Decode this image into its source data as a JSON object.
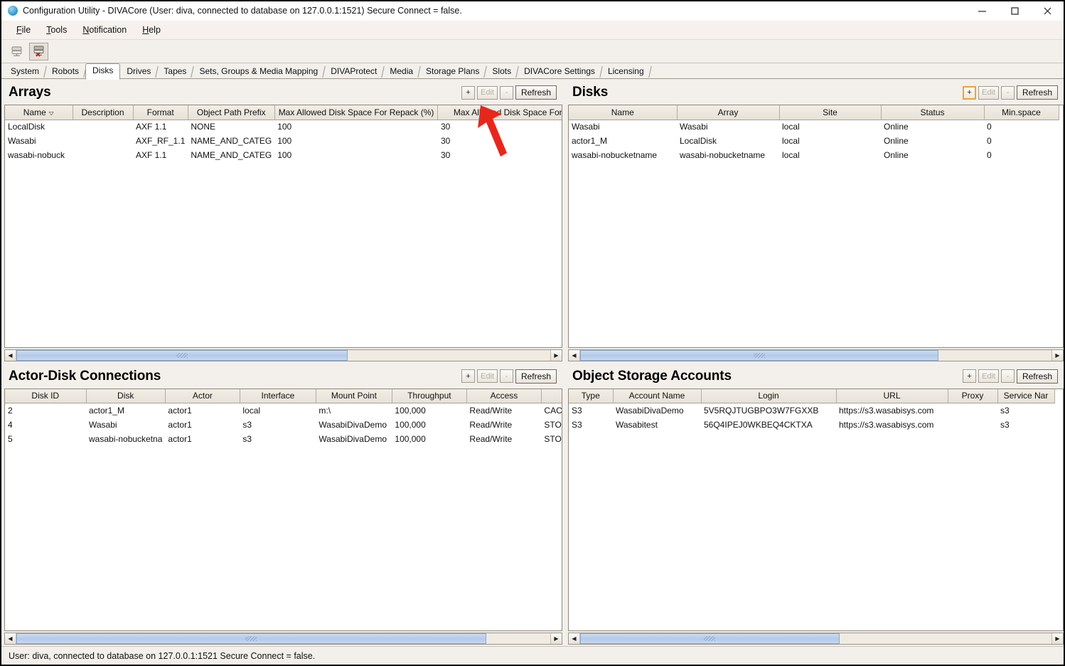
{
  "window": {
    "title": "Configuration Utility - DIVACore (User: diva, connected to database on 127.0.0.1:1521) Secure Connect = false.",
    "minimize_label": "–",
    "maximize_label": "□",
    "close_label": "✕"
  },
  "menubar": {
    "items": [
      {
        "label": "File",
        "mnemonic": "F"
      },
      {
        "label": "Tools",
        "mnemonic": "T"
      },
      {
        "label": "Notification",
        "mnemonic": "N"
      },
      {
        "label": "Help",
        "mnemonic": "H"
      }
    ]
  },
  "toolbar": {
    "buttons": [
      {
        "name": "connect-database-icon",
        "title": "Connect"
      },
      {
        "name": "disconnect-database-icon",
        "title": "Disconnect"
      }
    ]
  },
  "tabs": {
    "selected": "Disks",
    "items": [
      "System",
      "Robots",
      "Disks",
      "Drives",
      "Tapes",
      "Sets, Groups & Media Mapping",
      "DIVAProtect",
      "Media",
      "Storage Plans",
      "Slots",
      "DIVACore Settings",
      "Licensing"
    ]
  },
  "common": {
    "add_label": "+",
    "edit_label": "Edit",
    "remove_label": "-",
    "refresh_label": "Refresh"
  },
  "arrays": {
    "title": "Arrays",
    "columns": [
      "Name",
      "Description",
      "Format",
      "Object Path Prefix",
      "Max Allowed Disk Space For Repack (%)",
      "Max Allowed Disk Space For Migra"
    ],
    "sort_column": "Name",
    "sort_direction": "descending",
    "rows": [
      {
        "name": "LocalDisk",
        "description": "",
        "format": "AXF 1.1",
        "object_path_prefix": "NONE",
        "max_repack": "100",
        "max_migrate": "30"
      },
      {
        "name": "Wasabi",
        "description": "",
        "format": "AXF_RF_1.1",
        "object_path_prefix": "NAME_AND_CATEG",
        "max_repack": "100",
        "max_migrate": "30"
      },
      {
        "name": "wasabi-nobuck",
        "description": "",
        "format": "AXF 1.1",
        "object_path_prefix": "NAME_AND_CATEG",
        "max_repack": "100",
        "max_migrate": "30"
      }
    ]
  },
  "disks": {
    "title": "Disks",
    "columns": [
      "Name",
      "Array",
      "Site",
      "Status",
      "Min.space"
    ],
    "rows": [
      {
        "name": "Wasabi",
        "array": "Wasabi",
        "site": "local",
        "status": "Online",
        "min_space": "0"
      },
      {
        "name": "actor1_M",
        "array": "LocalDisk",
        "site": "local",
        "status": "Online",
        "min_space": "0"
      },
      {
        "name": "wasabi-nobucketname",
        "array": "wasabi-nobucketname",
        "site": "local",
        "status": "Online",
        "min_space": "0"
      }
    ]
  },
  "actor_disk_connections": {
    "title": "Actor-Disk Connections",
    "columns": [
      "Disk ID",
      "Disk",
      "Actor",
      "Interface",
      "Mount Point",
      "Throughput",
      "Access",
      ""
    ],
    "rows": [
      {
        "disk_id": "2",
        "disk": "actor1_M",
        "actor": "actor1",
        "interface": "local",
        "mount_point": "m:\\",
        "throughput": "100,000",
        "access": "Read/Write",
        "extra": "CAC"
      },
      {
        "disk_id": "4",
        "disk": "Wasabi",
        "actor": "actor1",
        "interface": "s3",
        "mount_point": "WasabiDivaDemo",
        "throughput": "100,000",
        "access": "Read/Write",
        "extra": "STO"
      },
      {
        "disk_id": "5",
        "disk": "wasabi-nobucketna",
        "actor": "actor1",
        "interface": "s3",
        "mount_point": "WasabiDivaDemo",
        "throughput": "100,000",
        "access": "Read/Write",
        "extra": "STO"
      }
    ]
  },
  "object_storage_accounts": {
    "title": "Object Storage Accounts",
    "columns": [
      "Type",
      "Account Name",
      "Login",
      "URL",
      "Proxy",
      "Service Nar"
    ],
    "rows": [
      {
        "type": "S3",
        "account_name": "WasabiDivaDemo",
        "login": "5V5RQJTUGBPO3W7FGXXB",
        "url": "https://s3.wasabisys.com",
        "proxy": "",
        "service_name": "s3"
      },
      {
        "type": "S3",
        "account_name": "Wasabitest",
        "login": "56Q4IPEJ0WKBEQ4CKTXA",
        "url": "https://s3.wasabisys.com",
        "proxy": "",
        "service_name": "s3"
      }
    ]
  },
  "statusbar": {
    "text": "User: diva, connected to database on 127.0.0.1:1521 Secure Connect = false."
  },
  "annotation": {
    "arrow_color": "#e8271c",
    "points_at": "arrays-add-button"
  }
}
